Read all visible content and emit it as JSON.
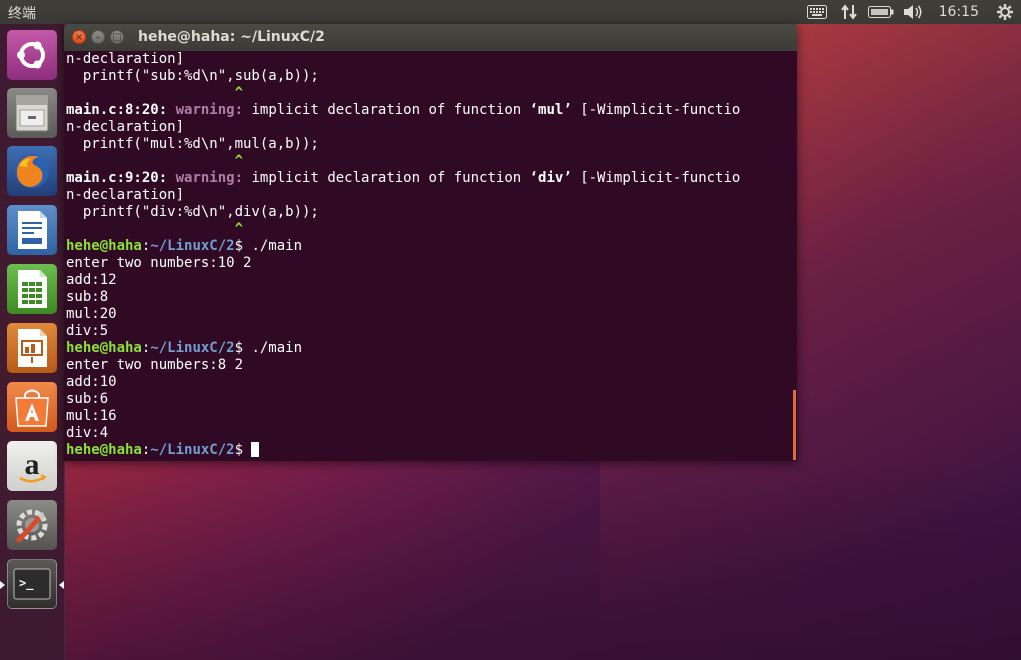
{
  "top_panel": {
    "app_title": "终端",
    "clock": "16:15",
    "indicators": [
      "keyboard-icon",
      "network-icon",
      "battery-icon",
      "volume-icon"
    ],
    "settings_icon": "gear-icon"
  },
  "launcher": {
    "items": [
      {
        "name": "ubuntu-dash",
        "icon": "ubuntu-logo-icon"
      },
      {
        "name": "files",
        "icon": "file-cabinet-icon"
      },
      {
        "name": "firefox",
        "icon": "firefox-icon"
      },
      {
        "name": "libreoffice-writer",
        "icon": "writer-icon"
      },
      {
        "name": "libreoffice-calc",
        "icon": "calc-icon"
      },
      {
        "name": "libreoffice-impress",
        "icon": "impress-icon"
      },
      {
        "name": "ubuntu-software",
        "icon": "shopping-bag-icon"
      },
      {
        "name": "amazon",
        "icon": "amazon-icon"
      },
      {
        "name": "system-settings",
        "icon": "settings-wrench-icon"
      },
      {
        "name": "terminal",
        "icon": "terminal-icon"
      }
    ],
    "amazon_letter": "a",
    "terminal_glyph": ">_"
  },
  "window": {
    "title": "hehe@haha: ~/LinuxC/2",
    "close_glyph": "×",
    "min_glyph": "–",
    "max_glyph": "□"
  },
  "terminal": {
    "l1": "n-declaration]",
    "l2": "  printf(\"sub:%d\\n\",sub(a,b));",
    "l3": "                    ^",
    "w1_loc": "main.c:8:20:",
    "w_label": "warning:",
    "w1_text_a": " implicit declaration of function ",
    "w1_fn": "‘mul’",
    "w1_text_b": " [-Wimplicit-functio",
    "l5": "n-declaration]",
    "l6": "  printf(\"mul:%d\\n\",mul(a,b));",
    "l7": "                    ^",
    "w2_loc": "main.c:9:20:",
    "w2_fn": "‘div’",
    "l9": "n-declaration]",
    "l10": "  printf(\"div:%d\\n\",div(a,b));",
    "l11": "                    ^",
    "prompt_user": "hehe@haha",
    "prompt_sep": ":",
    "prompt_path": "~/LinuxC/2",
    "prompt_dollar": "$ ",
    "cmd": "./main",
    "run1": [
      "enter two numbers:10 2",
      "add:12",
      "sub:8",
      "mul:20",
      "div:5"
    ],
    "run2": [
      "enter two numbers:8 2",
      "add:10",
      "sub:6",
      "mul:16",
      "div:4"
    ]
  },
  "colors": {
    "terminal_bg": "#300a24",
    "prompt_user": "#8ae234",
    "prompt_path": "#729fcf",
    "warning": "#ad7fa8",
    "scrollbar": "#e06c3c"
  }
}
